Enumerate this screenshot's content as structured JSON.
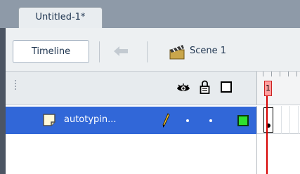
{
  "document_tab": {
    "label": "Untitled-1*"
  },
  "edit_bar": {
    "timeline_label": "Timeline",
    "back_icon": "back-arrow-icon",
    "scene_icon": "clapperboard-icon",
    "scene_label": "Scene 1"
  },
  "timeline_header": {
    "icons": [
      "eye-icon",
      "lock-icon",
      "outline-icon"
    ],
    "current_frame": "1"
  },
  "layers": [
    {
      "name": "autotypin...",
      "icon": "layer-icon",
      "edit_icon": "pencil-icon",
      "visible": "•",
      "locked": "•",
      "outline_color": "#2ee02e",
      "selected": true
    }
  ],
  "colors": {
    "selection": "#3167d8",
    "playhead": "#d60000",
    "tab_strip": "#8e9aa8"
  }
}
